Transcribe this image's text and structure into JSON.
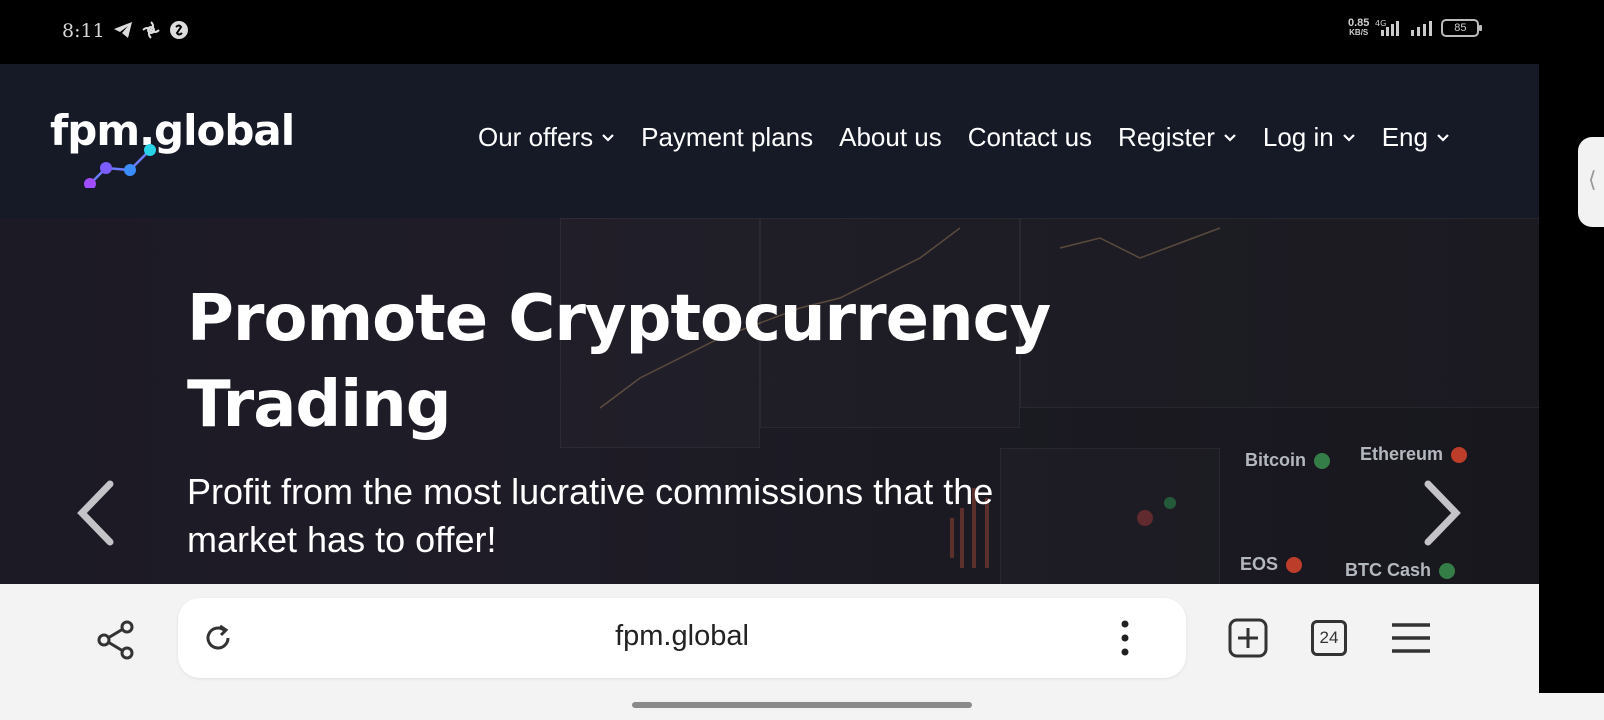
{
  "status_bar": {
    "time": "8:11",
    "net_speed": "0.85",
    "net_unit": "KB/S",
    "network": "4G",
    "battery": "85",
    "left_icons": [
      "telegram-icon",
      "pinwheel-icon",
      "shazam-icon"
    ]
  },
  "header": {
    "logo": "fpm.global",
    "nav": [
      {
        "label": "Our offers",
        "dropdown": true
      },
      {
        "label": "Payment plans",
        "dropdown": false
      },
      {
        "label": "About us",
        "dropdown": false
      },
      {
        "label": "Contact us",
        "dropdown": false
      },
      {
        "label": "Register",
        "dropdown": true
      },
      {
        "label": "Log in",
        "dropdown": true
      },
      {
        "label": "Eng",
        "dropdown": true
      }
    ]
  },
  "hero": {
    "title": "Promote Cryptocurrency Trading",
    "subtitle": "Profit from the most lucrative commissions that the market has to offer!",
    "bg_labels": [
      "Bitcoin",
      "Ethereum",
      "EOS",
      "BTC Cash"
    ]
  },
  "browser": {
    "url": "fpm.global",
    "tab_count": "24"
  },
  "colors": {
    "header_bg": "#161a27",
    "logo_purple": "#a04dff",
    "logo_blue": "#3b8cff",
    "logo_cyan": "#29d3e6",
    "browser_bg": "#f3f3f3"
  }
}
